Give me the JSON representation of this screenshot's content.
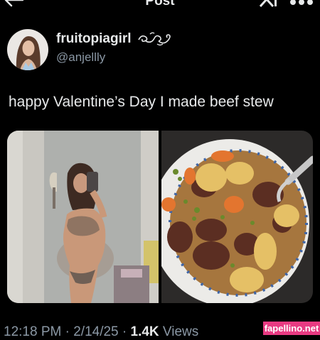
{
  "header": {
    "title": "Post",
    "back_icon": "back-arrow-icon",
    "right_icons": [
      "x-logo-icon",
      "more-icon"
    ]
  },
  "post": {
    "author": {
      "display_name": "fruitopiagirl",
      "handle": "@anjellly",
      "decoration": "swirl-ornament-icon"
    },
    "text": "happy Valentine’s Day I made beef stew",
    "media": [
      {
        "kind": "photo",
        "subject": "mirror-selfie"
      },
      {
        "kind": "photo",
        "subject": "bowl-of-beef-stew"
      }
    ],
    "meta": {
      "time": "12:18 PM",
      "sep1": " · ",
      "date": "2/14/25",
      "sep2": " · ",
      "views_count": "1.4K",
      "views_label": " Views"
    }
  },
  "watermark": "fapellino.net",
  "colors": {
    "background": "#000000",
    "primary_text": "#e7e9ea",
    "secondary_text": "#8b98a5",
    "watermark_bg": "#e83a82"
  }
}
